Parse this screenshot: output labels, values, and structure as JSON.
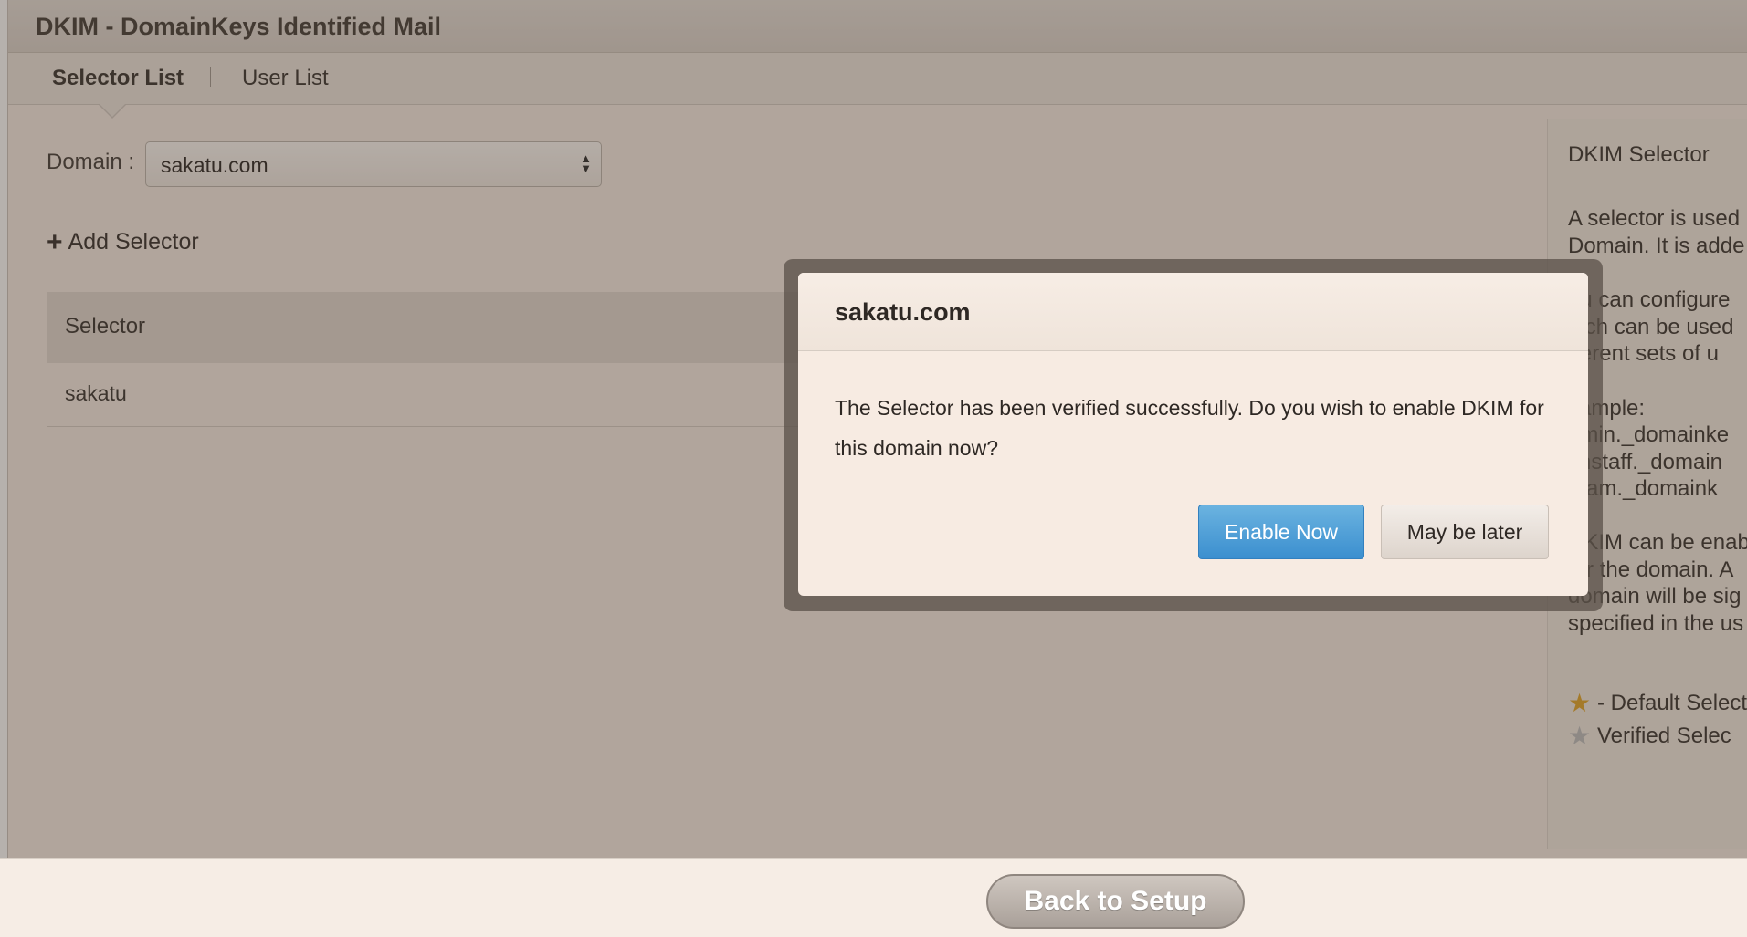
{
  "app": {
    "title": "DKIM - DomainKeys Identified Mail"
  },
  "tabs": [
    {
      "label": "Selector List",
      "active": true
    },
    {
      "label": "User List",
      "active": false
    }
  ],
  "domain": {
    "label": "Domain :",
    "selected": "sakatu.com"
  },
  "add_selector_label": "Add Selector",
  "table": {
    "header": "Selector",
    "rows": [
      "sakatu"
    ]
  },
  "sidepanel": {
    "title": "DKIM Selector",
    "lines": [
      "A selector is used",
      "Domain. It is adde",
      "ou can configure",
      "hich can be used",
      "fferent sets of u",
      "xample:",
      "dmin._domainke",
      "chstaff._domain",
      "team._domaink",
      "DKIM can be enab",
      "for the domain. A",
      "domain will be sig",
      "specified in the us",
      "- Default Select",
      "Verified Selec"
    ]
  },
  "modal": {
    "title": "sakatu.com",
    "message": "The Selector has been verified successfully. Do you wish to enable DKIM for this domain now?",
    "primary_button": "Enable Now",
    "secondary_button": "May be later"
  },
  "footer": {
    "back_button": "Back to Setup"
  },
  "colors": {
    "primary_button": "#3b8fcf",
    "star": "#e0a11c"
  }
}
